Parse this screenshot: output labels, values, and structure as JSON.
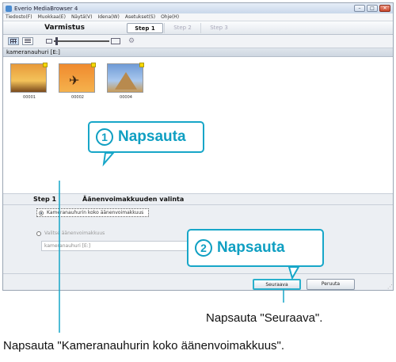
{
  "window": {
    "title": "Everio MediaBrowser 4"
  },
  "menu": [
    "Tiedosto(F)",
    "Muokkaa(E)",
    "Näytä(V)",
    "Idena(W)",
    "Asetukset(S)",
    "Ohje(H)"
  ],
  "tabs": {
    "app_tab": "Varmistus",
    "steps": [
      "Step 1",
      "Step 2",
      "Step 3"
    ]
  },
  "source": {
    "label": "kameranauhuri [E:]"
  },
  "thumbnails": [
    {
      "caption": "00001",
      "kind": "sunset"
    },
    {
      "caption": "00002",
      "kind": "airplane"
    },
    {
      "caption": "00004",
      "kind": "pyramid"
    }
  ],
  "step_panel": {
    "step_label": "Step 1",
    "heading": "Äänenvoimakkuuden valinta",
    "option1": "Kameranauhurin koko äänenvoimakkuus",
    "option2": "Valitse äänenvoimakkuus",
    "select_value": "kameranauhuri [E:]"
  },
  "buttons": {
    "next": "Seuraava",
    "cancel": "Peruuta"
  },
  "callouts": [
    {
      "number": "1",
      "text": "Napsauta"
    },
    {
      "number": "2",
      "text": "Napsauta"
    }
  ],
  "annotations": {
    "next_instruction": "Napsauta \"Seuraava\".",
    "option_instruction": "Napsauta \"Kameranauhurin koko äänenvoimakkuus\"."
  },
  "colors": {
    "callout": "#17a6c8",
    "close": "#c9462a"
  }
}
